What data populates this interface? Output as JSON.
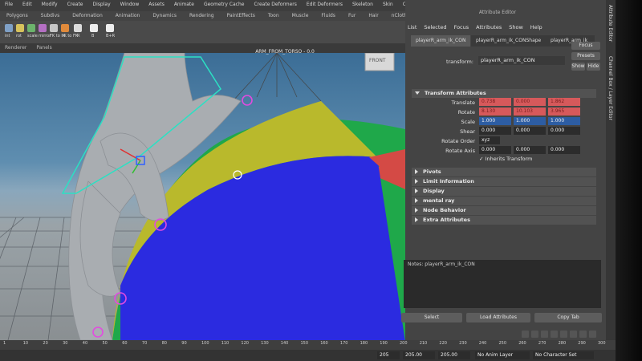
{
  "menubar": [
    "File",
    "Edit",
    "Modify",
    "Create",
    "Display",
    "Window",
    "Assets",
    "Animate",
    "Geometry Cache",
    "Create Deformers",
    "Edit Deformers",
    "Skeleton",
    "Skin",
    "Constrain",
    "Character",
    "Muscle",
    "Pipeline Cache",
    "Help"
  ],
  "shelf_tabs": [
    "Polygons",
    "Subdivs",
    "Deformation",
    "Animation",
    "Dynamics",
    "Rendering",
    "PaintEffects",
    "Toon",
    "Muscle",
    "Fluids",
    "Fur",
    "Hair",
    "nCloth",
    "Custom"
  ],
  "shelf_labels": [
    "int",
    "rot",
    "scale",
    "mirror",
    "FK to IK",
    "IK to FK",
    "R",
    "B",
    "B+R"
  ],
  "panel_menu": [
    "Renderer",
    "Panels"
  ],
  "viewport": {
    "camera_title": "ARM_FROM_TORSO - 0.0",
    "view_cube": "FRONT"
  },
  "attribute_editor": {
    "title": "Attribute Editor",
    "menu": [
      "List",
      "Selected",
      "Focus",
      "Attributes",
      "Show",
      "Help"
    ],
    "node_tabs": [
      "playerR_arm_ik_CON",
      "playerR_arm_ik_CONShape",
      "playerR_arm_ik_"
    ],
    "transform_label": "transform:",
    "transform_value": "playerR_arm_ik_CON",
    "buttons": {
      "focus": "Focus",
      "presets": "Presets",
      "show": "Show",
      "hide": "Hide"
    },
    "sections": {
      "transform": "Transform Attributes",
      "collapsed": [
        "Pivots",
        "Limit Information",
        "Display",
        "mental ray",
        "Node Behavior",
        "Extra Attributes"
      ]
    },
    "attrs": {
      "translate": {
        "label": "Translate",
        "values": [
          "0.738",
          "0.000",
          "1.862"
        ]
      },
      "rotate": {
        "label": "Rotate",
        "values": [
          "8.130",
          "10.103",
          "3.965"
        ]
      },
      "scale": {
        "label": "Scale",
        "values": [
          "1.000",
          "1.000",
          "1.000"
        ]
      },
      "shear": {
        "label": "Shear",
        "values": [
          "0.000",
          "0.000",
          "0.000"
        ]
      },
      "rotate_order": {
        "label": "Rotate Order",
        "value": "xyz"
      },
      "rotate_axis": {
        "label": "Rotate Axis",
        "values": [
          "0.000",
          "0.000",
          "0.000"
        ]
      },
      "inherits": {
        "label": "Inherits Transform",
        "checked": true
      }
    },
    "notes_label": "Notes: playerR_arm_ik_CON",
    "bottom_buttons": [
      "Select",
      "Load Attributes",
      "Copy Tab"
    ]
  },
  "side_tabs": [
    "Attribute Editor",
    "Channel Box / Layer Editor"
  ],
  "timeline": {
    "ticks": [
      "1",
      "10",
      "20",
      "30",
      "40",
      "50",
      "60",
      "70",
      "80",
      "90",
      "100",
      "110",
      "120",
      "130",
      "140",
      "150",
      "160",
      "170",
      "180",
      "190",
      "200",
      "210",
      "220",
      "230",
      "240",
      "250",
      "260",
      "270",
      "280",
      "290",
      "300"
    ],
    "range_fields": [
      "205",
      "205.00",
      "205.00"
    ],
    "anim_layer": "No Anim Layer",
    "character_set": "No Character Set"
  },
  "colors": {
    "translate_rotate": "#d6595b",
    "scale": "#2d5da3",
    "ball_blue": "#2b2be0",
    "ball_yellow": "#b9b92c",
    "ball_green": "#1fa84a",
    "ball_red": "#d44a45",
    "handle": "#e24be0",
    "selection_box": "#2ce0c3"
  }
}
